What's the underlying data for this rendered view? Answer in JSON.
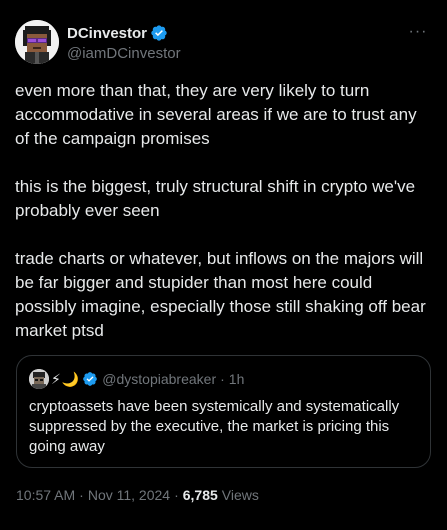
{
  "author": {
    "display_name": "DCinvestor",
    "handle": "@iamDCinvestor",
    "verified": true,
    "avatar_icon": "pixel-art-avatar"
  },
  "menu": {
    "more_label": "···"
  },
  "tweet": {
    "paragraphs": [
      "even more than that, they are very likely to turn accommodative in several areas if we are to trust any of the campaign promises",
      "this is the biggest, truly structural shift in crypto we've probably ever seen",
      "trade charts or whatever, but inflows on the majors will be far bigger and stupider than most here could possibly imagine, especially those still shaking off bear market ptsd"
    ]
  },
  "quote": {
    "emojis": [
      "⚡",
      "🌙"
    ],
    "verified": true,
    "handle": "@dystopiabreaker",
    "separator": "·",
    "time": "1h",
    "text": "cryptoassets have been systemically and systematically suppressed by the executive, the market is pricing this going away"
  },
  "footer": {
    "time": "10:57 AM",
    "separator": "·",
    "date": "Nov 11, 2024",
    "views_count": "6,785",
    "views_label": "Views"
  },
  "colors": {
    "background": "#000000",
    "text": "#e7e9ea",
    "muted": "#71767b",
    "border": "#2f3336",
    "verified": "#1d9bf0"
  }
}
